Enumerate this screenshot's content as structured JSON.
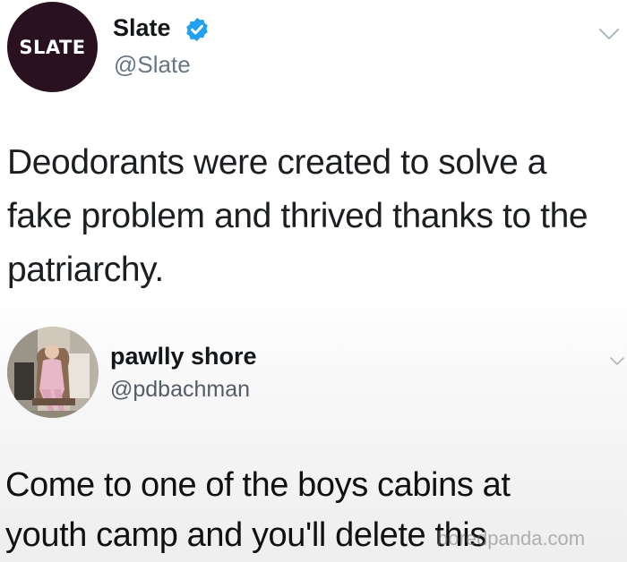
{
  "tweet_top": {
    "avatar_logo_text": "SLATE",
    "display_name": "Slate",
    "handle": "@Slate",
    "verified": true,
    "text_lines": [
      "Deodorants were created to solve a",
      "fake problem and thrived thanks to the",
      "patriarchy."
    ],
    "menu_icon": "chevron-down-icon"
  },
  "tweet_reply": {
    "display_name": "pawlly shore",
    "handle": "@pdbachman",
    "text_lines": [
      "Come to one of the boys cabins at",
      "youth camp and you'll delete this"
    ],
    "menu_icon": "chevron-down-icon"
  },
  "watermark": "boredpanda.com",
  "colors": {
    "slate_brand": "#2a1120",
    "verified_blue": "#1da1f2",
    "handle_gray": "#657786",
    "text_dark": "#14171a"
  }
}
